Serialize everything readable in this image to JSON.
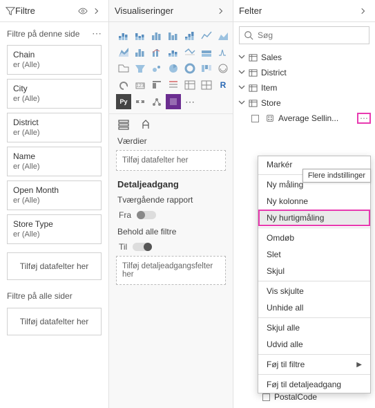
{
  "filters": {
    "panel_title": "Filtre",
    "section_this_page": "Filtre på denne side",
    "section_all_pages": "Filtre på alle sider",
    "cards": [
      {
        "name": "Chain",
        "value": "er (Alle)"
      },
      {
        "name": "City",
        "value": "er (Alle)"
      },
      {
        "name": "District",
        "value": "er (Alle)"
      },
      {
        "name": "Name",
        "value": "er (Alle)"
      },
      {
        "name": "Open Month",
        "value": "er (Alle)"
      },
      {
        "name": "Store Type",
        "value": "er (Alle)"
      }
    ],
    "add_placeholder": "Tilføj datafelter her"
  },
  "viz": {
    "panel_title": "Visualiseringer",
    "values_label": "Værdier",
    "values_placeholder": "Tilføj datafelter her",
    "drill_heading": "Detaljeadgang",
    "cross_report_label": "Tværgående rapport",
    "cross_report_state": "Fra",
    "keep_filters_label": "Behold alle filtre",
    "keep_filters_state": "Til",
    "drill_placeholder": "Tilføj detaljeadgangsfelter her"
  },
  "fields": {
    "panel_title": "Felter",
    "search_placeholder": "Søg",
    "tables": [
      {
        "name": "Sales",
        "expanded": false
      },
      {
        "name": "District",
        "expanded": false
      },
      {
        "name": "Item",
        "expanded": false
      },
      {
        "name": "Store",
        "expanded": true
      }
    ],
    "store_child": "Average Sellin...",
    "more_tooltip": "Flere indstillinger",
    "partial_bottom": [
      "PostalCode"
    ]
  },
  "context_menu": {
    "groups": [
      [
        "Markér"
      ],
      [
        "Ny måling",
        "Ny kolonne",
        "Ny hurtigmåling"
      ],
      [
        "Omdøb",
        "Slet",
        "Skjul"
      ],
      [
        "Vis skjulte",
        "Unhide all"
      ],
      [
        "Skjul alle",
        "Udvid alle"
      ],
      [
        "Føj til filtre"
      ],
      [
        "Føj til detaljeadgang"
      ]
    ],
    "highlighted": "Ny hurtigmåling",
    "submenu": "Føj til filtre"
  }
}
